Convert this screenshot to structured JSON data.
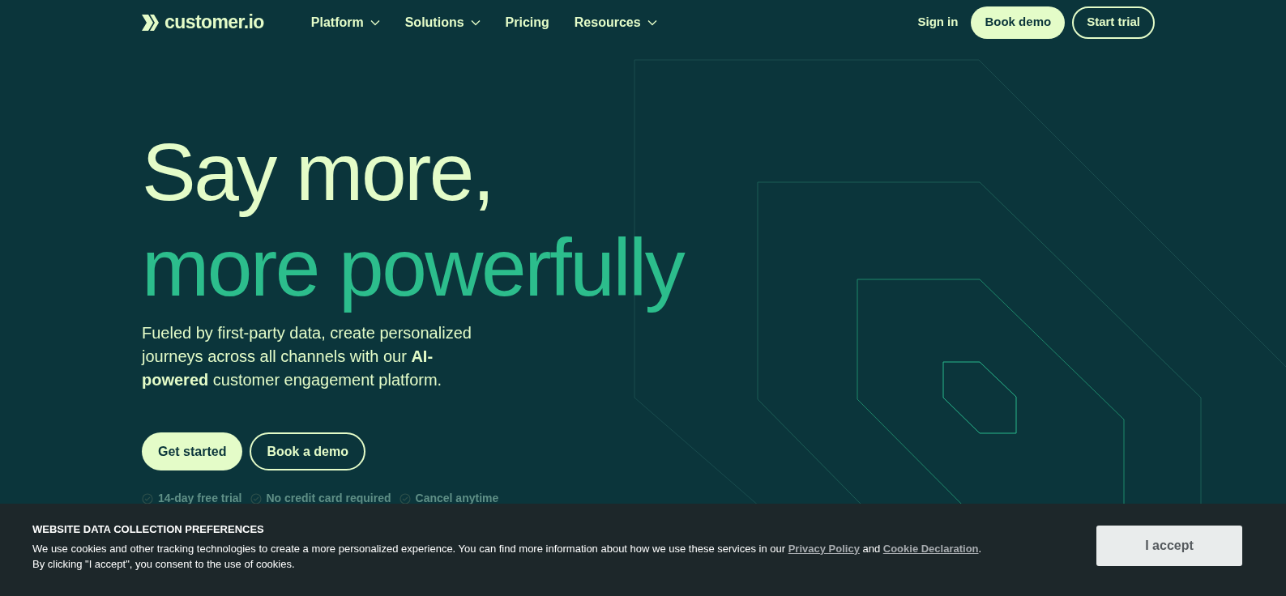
{
  "header": {
    "logo": "customer.io",
    "nav": [
      {
        "label": "Platform",
        "dropdown": true
      },
      {
        "label": "Solutions",
        "dropdown": true
      },
      {
        "label": "Pricing",
        "dropdown": false
      },
      {
        "label": "Resources",
        "dropdown": true
      }
    ],
    "sign_in": "Sign in",
    "book_demo": "Book demo",
    "start_trial": "Start trial"
  },
  "hero": {
    "headline_line1": "Say more,",
    "headline_line2": "more powerfully",
    "description": "Fueled by first-party data, create personalized journeys across all channels with our **AI-powered** customer engagement platform.",
    "primary_button": "Get started",
    "secondary_button": "Book a demo",
    "perks": [
      "14-day free trial",
      "No credit card required",
      "Cancel anytime"
    ]
  },
  "cookie_banner": {
    "title": "WEBSITE DATA COLLECTION PREFERENCES",
    "body": [
      {
        "kind": "text",
        "text": "We use cookies and other tracking technologies to create a more personalized experience. You can find more information about how we use these services in our "
      },
      {
        "kind": "link",
        "text": "Privacy Policy"
      },
      {
        "kind": "text",
        "text": " and "
      },
      {
        "kind": "link",
        "text": "Cookie Declaration"
      },
      {
        "kind": "text",
        "text": ". By clicking \"I accept\", you consent to the use of cookies."
      }
    ],
    "accept_button": "I accept"
  }
}
